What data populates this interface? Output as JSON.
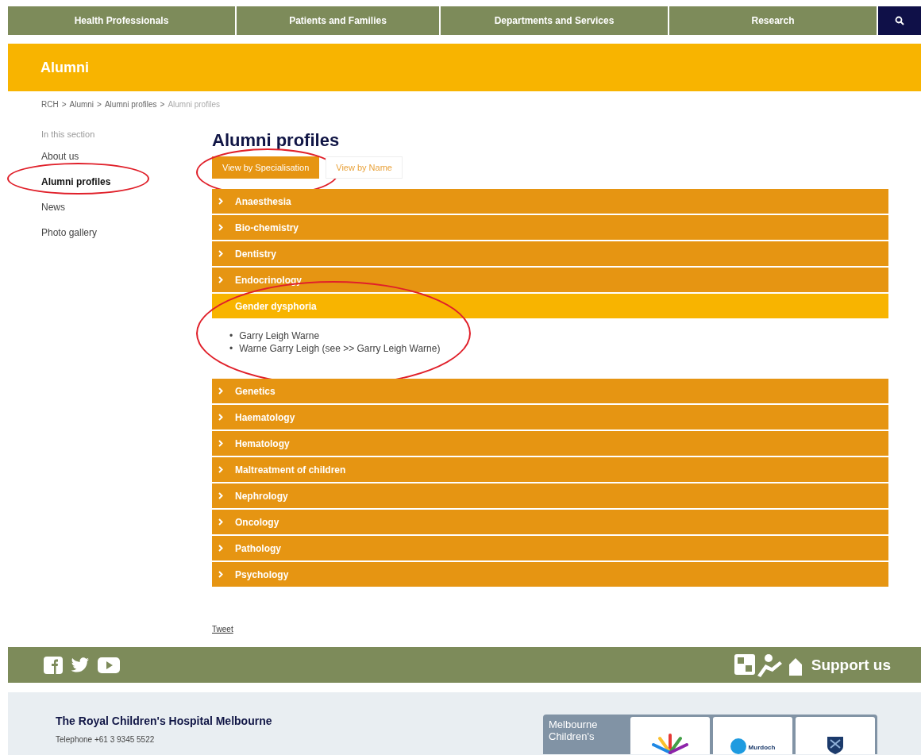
{
  "nav": {
    "items": [
      {
        "label": "Health Professionals"
      },
      {
        "label": "Patients and Families"
      },
      {
        "label": "Departments and Services"
      },
      {
        "label": "Research"
      }
    ]
  },
  "banner": {
    "title": "Alumni"
  },
  "breadcrumb": [
    "RCH",
    ">",
    "Alumni",
    ">",
    "Alumni profiles",
    ">",
    "Alumni profiles"
  ],
  "sidebar": {
    "heading": "In this section",
    "items": [
      {
        "label": "About us",
        "selected": false,
        "circled": false
      },
      {
        "label": "Alumni profiles",
        "selected": true,
        "circled": true
      },
      {
        "label": "News",
        "selected": false,
        "circled": false
      },
      {
        "label": "Photo gallery",
        "selected": false,
        "circled": false
      }
    ]
  },
  "main": {
    "title": "Alumni profiles",
    "tabs": [
      {
        "label": "View by Specialisation",
        "selected": true,
        "circled": true
      },
      {
        "label": "View by Name",
        "selected": false,
        "circled": false
      }
    ],
    "sections": [
      {
        "label": "Anaesthesia",
        "expanded": false,
        "circled": false
      },
      {
        "label": "Bio-chemistry",
        "expanded": false,
        "circled": false
      },
      {
        "label": "Dentistry",
        "expanded": false,
        "circled": false
      },
      {
        "label": "Endocrinology",
        "expanded": false,
        "circled": false
      },
      {
        "label": "Gender dysphoria",
        "expanded": true,
        "circled": true,
        "items": [
          {
            "bullet": "•",
            "text": "Garry Leigh Warne"
          },
          {
            "bullet": "•",
            "text": "Warne Garry Leigh (see >> Garry Leigh Warne)"
          }
        ]
      },
      {
        "label": "Genetics",
        "expanded": false,
        "circled": false
      },
      {
        "label": "Haematology",
        "expanded": false,
        "circled": false
      },
      {
        "label": "Hematology",
        "expanded": false,
        "circled": false
      },
      {
        "label": "Maltreatment of children",
        "expanded": false,
        "circled": false
      },
      {
        "label": "Nephrology",
        "expanded": false,
        "circled": false
      },
      {
        "label": "Oncology",
        "expanded": false,
        "circled": false
      },
      {
        "label": "Pathology",
        "expanded": false,
        "circled": false
      },
      {
        "label": "Psychology",
        "expanded": false,
        "circled": false
      }
    ],
    "tweet": "Tweet"
  },
  "footer": {
    "support": "Support us",
    "org": "The Royal Children's Hospital Melbourne",
    "phone": "Telephone +61 3 9345 5522",
    "campus_label": "Melbourne Children's",
    "partner": "Murdoch"
  }
}
